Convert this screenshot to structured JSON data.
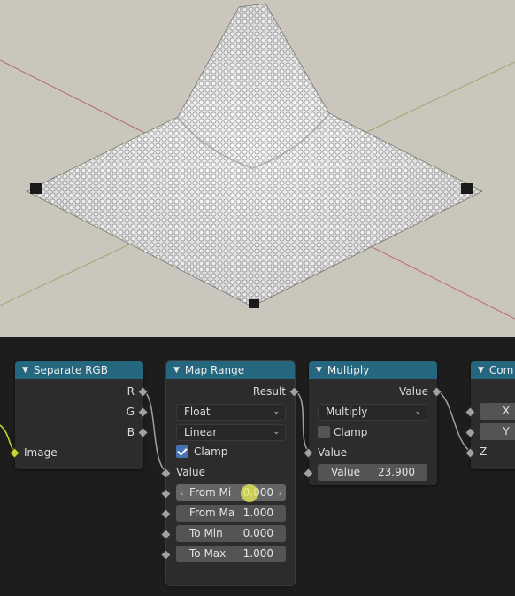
{
  "nodes": {
    "separate_rgb": {
      "title": "Separate RGB",
      "outputs": [
        "R",
        "G",
        "B"
      ],
      "input": "Image"
    },
    "map_range": {
      "title": "Map Range",
      "output": "Result",
      "data_type": "Float",
      "interpolation": "Linear",
      "clamp_label": "Clamp",
      "clamp_checked": true,
      "value_label": "Value",
      "from_min_label": "From Mi",
      "from_min_value": "0.000",
      "from_max_label": "From Ma",
      "from_max_value": "1.000",
      "to_min_label": "To Min",
      "to_min_value": "0.000",
      "to_max_label": "To Max",
      "to_max_value": "1.000"
    },
    "multiply": {
      "title": "Multiply",
      "output": "Value",
      "operation": "Multiply",
      "clamp_label": "Clamp",
      "clamp_checked": false,
      "value_label": "Value",
      "value_field_label": "Value",
      "value_field_value": "23.900"
    },
    "combine_xyz": {
      "title": "Com",
      "x": "X",
      "y": "Y",
      "z": "Z"
    }
  },
  "colors": {
    "header": "#25677f",
    "node_body": "#2c2c2c",
    "editor_bg": "#1d1d1d",
    "viewport_bg": "#cac6bc",
    "geometry_socket": "#c7d632",
    "value_socket": "#a1a1a1",
    "checkbox_on": "#4772b3"
  }
}
